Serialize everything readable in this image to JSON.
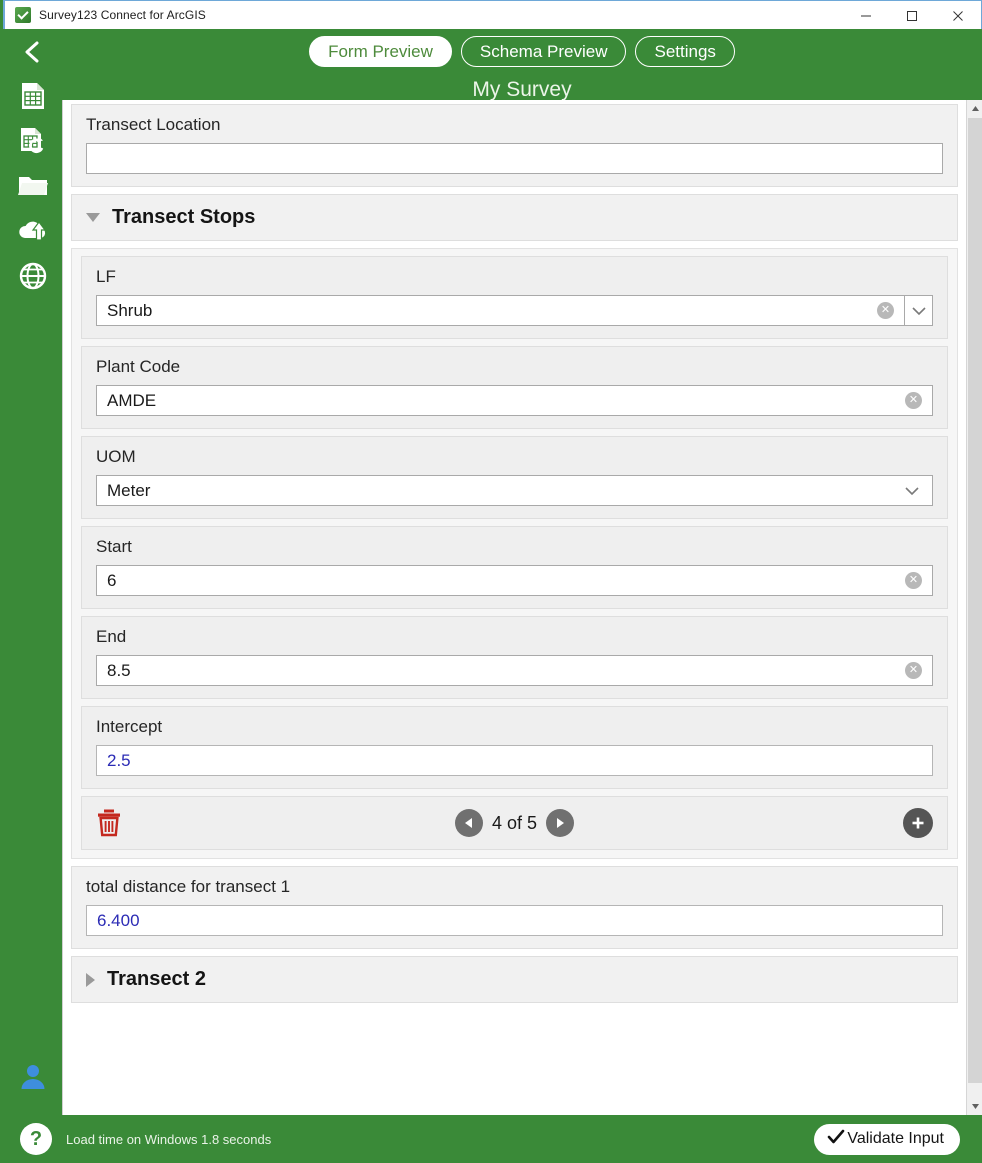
{
  "window": {
    "title": "Survey123 Connect for ArcGIS",
    "app_icon": "survey123-icon",
    "controls": {
      "minimize": "minimize-icon",
      "maximize": "maximize-icon",
      "close": "close-icon"
    }
  },
  "rail": {
    "back": "back-chevron-icon",
    "items": [
      {
        "icon": "form-spreadsheet-icon",
        "name": "sidebar-item-form"
      },
      {
        "icon": "form-refresh-icon",
        "name": "sidebar-item-refresh"
      },
      {
        "icon": "folder-icon",
        "name": "sidebar-item-folder"
      },
      {
        "icon": "cloud-upload-icon",
        "name": "sidebar-item-publish"
      },
      {
        "icon": "globe-icon",
        "name": "sidebar-item-web"
      }
    ],
    "user_icon": "user-avatar-icon"
  },
  "tabs": [
    {
      "label": "Form Preview",
      "active": true
    },
    {
      "label": "Schema Preview",
      "active": false
    },
    {
      "label": "Settings",
      "active": false
    }
  ],
  "survey": {
    "title": "My Survey"
  },
  "form": {
    "transect_location": {
      "label": "Transect Location",
      "value": "",
      "placeholder": ""
    },
    "transect_stops_group": {
      "label": "Transect Stops",
      "expanded": true,
      "toggle_icon": "triangle-down-icon"
    },
    "fields": [
      {
        "label": "LF",
        "value": "Shrub",
        "type": "combobox",
        "has_clear": true,
        "has_dropdown": true,
        "calculated": false
      },
      {
        "label": "Plant Code",
        "value": "AMDE",
        "type": "text",
        "has_clear": true,
        "has_dropdown": false,
        "calculated": false
      },
      {
        "label": "UOM",
        "value": "Meter",
        "type": "select",
        "has_clear": false,
        "has_dropdown": true,
        "calculated": false
      },
      {
        "label": "Start",
        "value": "6",
        "type": "number",
        "has_clear": true,
        "has_dropdown": false,
        "calculated": false
      },
      {
        "label": "End",
        "value": "8.5",
        "type": "number",
        "has_clear": true,
        "has_dropdown": false,
        "calculated": false
      },
      {
        "label": "Intercept",
        "value": "2.5",
        "type": "number",
        "has_clear": false,
        "has_dropdown": false,
        "calculated": true
      }
    ],
    "repeat_nav": {
      "delete_icon": "trash-icon",
      "prev_icon": "prev-arrow-icon",
      "next_icon": "next-arrow-icon",
      "counter": "4 of 5",
      "current": 4,
      "total": 5,
      "add_icon": "plus-icon"
    },
    "total_distance": {
      "label": "total distance for transect 1",
      "value": "6.400",
      "calculated": true
    },
    "transect_2_group": {
      "label": "Transect 2",
      "expanded": false,
      "toggle_icon": "triangle-right-icon"
    }
  },
  "statusbar": {
    "help_icon": "question-mark-icon",
    "message": "Load time on Windows 1.8 seconds",
    "validate_button": {
      "label": "Validate Input",
      "icon": "checkmark-icon"
    }
  },
  "colors": {
    "brand_green": "#3a8a38",
    "calculated_text": "#2b2bb5",
    "delete_red": "#c4291f",
    "card_bg": "#f1f1f1"
  }
}
